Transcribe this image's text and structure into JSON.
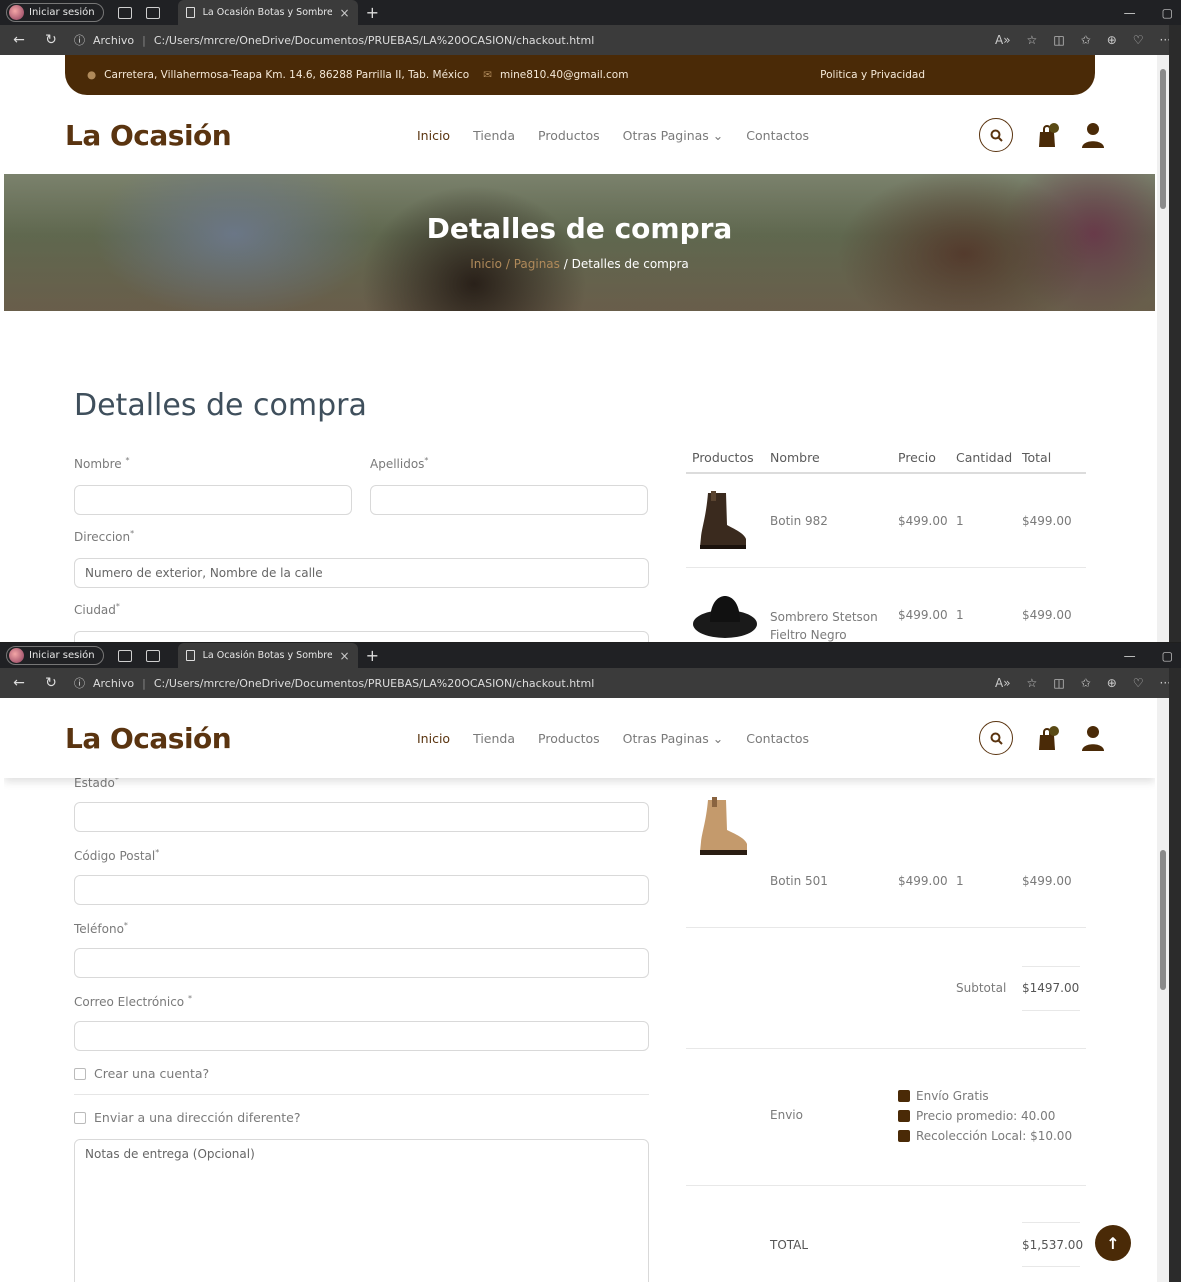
{
  "browser": {
    "profile_label": "Iniciar sesión",
    "tab_title": "La Ocasión Botas y Sombreros",
    "tab_close": "×",
    "new_tab": "+",
    "address_prefix": "Archivo",
    "address_sep": "|",
    "url": "C:/Users/mrcre/OneDrive/Documentos/PRUEBAS/LA%20OCASION/chackout.html"
  },
  "topbar": {
    "address": "Carretera, Villahermosa-Teapa Km. 14.6, 86288 Parrilla II, Tab. México",
    "email": "mine810.40@gmail.com",
    "policy": "Politica y Privacidad"
  },
  "site": {
    "logo": "La Ocasión",
    "menu": [
      "Inicio",
      "Tienda",
      "Productos",
      "Otras Paginas",
      "Contactos"
    ],
    "dropdown_caret": "⌄"
  },
  "hero": {
    "title": "Detalles de compra",
    "crumb_home": "Inicio",
    "crumb_pages": "Paginas",
    "crumb_sep": "/",
    "crumb_current": "Detalles de compra"
  },
  "form": {
    "heading": "Detalles de compra",
    "required_mark": "*",
    "nombre": "Nombre",
    "apellidos": "Apellidos",
    "direccion": "Direccion",
    "direccion_placeholder": "Numero de exterior, Nombre de la calle",
    "ciudad": "Ciudad",
    "estado": "Estado",
    "codigo_postal": "Código Postal",
    "telefono": "Teléfono",
    "correo": "Correo Electrónico",
    "crear_cuenta": "Crear una cuenta?",
    "enviar_diferente": "Enviar a una dirección diferente?",
    "notas_placeholder": "Notas de entrega (Opcional)"
  },
  "cart": {
    "headers": [
      "Productos",
      "Nombre",
      "Precio",
      "Cantidad",
      "Total"
    ],
    "items": [
      {
        "name": "Botin 982",
        "price": "$499.00",
        "qty": "1",
        "total": "$499.00"
      },
      {
        "name": "Sombrero Stetson Fieltro Negro",
        "price": "$499.00",
        "qty": "1",
        "total": "$499.00"
      },
      {
        "name": "Botin 501",
        "price": "$499.00",
        "qty": "1",
        "total": "$499.00"
      }
    ],
    "subtotal_label": "Subtotal",
    "subtotal_value": "$1497.00",
    "shipping_label": "Envio",
    "shipping_options": [
      "Envío Gratis",
      "Precio promedio: 40.00",
      "Recolección Local: $10.00"
    ],
    "total_label": "TOTAL",
    "total_value": "$1,537.00"
  },
  "icons": {
    "search": "search-icon",
    "cart": "shopping-bag-icon",
    "user": "user-icon",
    "back_to_top": "arrow-up-icon"
  },
  "colors": {
    "brand": "#4a2a07",
    "logo": "#5a3410",
    "heading": "#3f4f5c"
  }
}
